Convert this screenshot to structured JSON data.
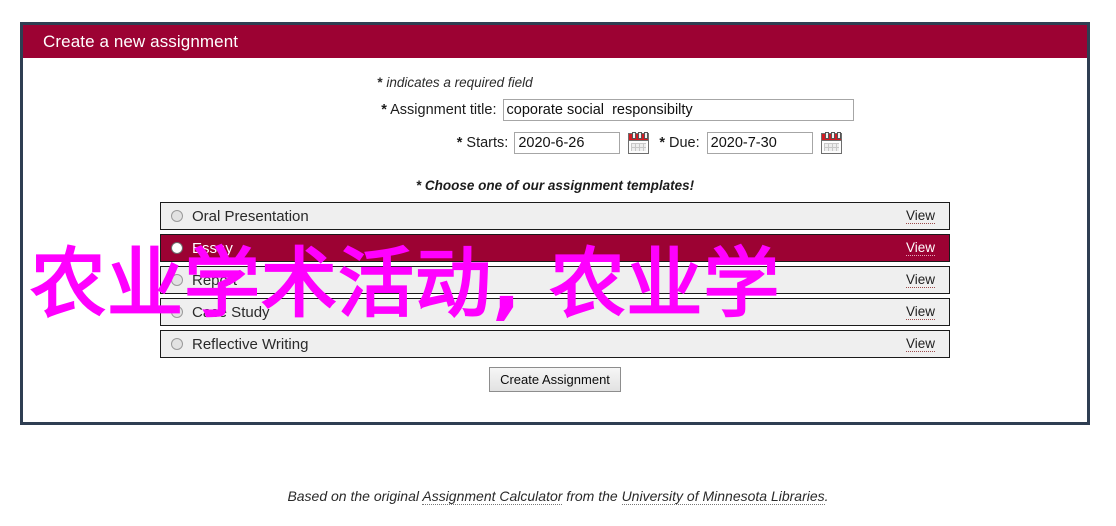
{
  "panel": {
    "header_title": "Create a new assignment",
    "required_note_star": "*",
    "required_note_text": " indicates a required field",
    "header_bg": "#9c0233",
    "border_color": "#2f3e52"
  },
  "form": {
    "title_field": {
      "star": "*",
      "label": " Assignment title:",
      "value": "coporate social  responsibilty",
      "placeholder": ""
    },
    "starts_field": {
      "star": "*",
      "label": " Starts:",
      "value": "2020-6-26",
      "placeholder": "",
      "calendar_icon": "calendar-icon"
    },
    "due_field": {
      "star": "*",
      "label": " Due:",
      "value": "2020-7-30",
      "placeholder": "",
      "calendar_icon": "calendar-icon"
    }
  },
  "templates": {
    "choose_note_star": "*",
    "choose_note_text": " Choose one of our assignment templates!",
    "view_label": "View",
    "selected_index": 1,
    "selected_bg": "#9c0233",
    "items": [
      {
        "label": "Oral Presentation",
        "view": "View",
        "selected": false
      },
      {
        "label": "Essay",
        "view": "View",
        "selected": true
      },
      {
        "label": "Report",
        "view": "View",
        "selected": false
      },
      {
        "label": "Case Study",
        "view": "View",
        "selected": false
      },
      {
        "label": "Reflective Writing",
        "view": "View",
        "selected": false
      }
    ]
  },
  "submit": {
    "label": "Create Assignment"
  },
  "footer": {
    "prefix": "Based on the original ",
    "link1": "Assignment Calculator",
    "middle": " from the ",
    "link2": "University of Minnesota Libraries",
    "suffix": "."
  },
  "watermark": {
    "text": "农业学术活动, 农业学",
    "color": "#ff00ff"
  }
}
